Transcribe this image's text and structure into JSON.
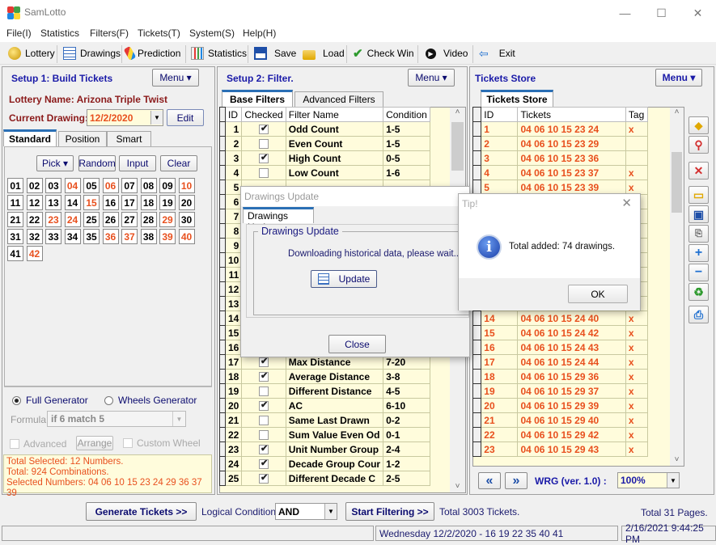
{
  "window": {
    "title": "SamLotto",
    "minimize": "—",
    "maximize": "☐",
    "close": "✕"
  },
  "menu": [
    "File(I)",
    "Statistics",
    "Filters(F)",
    "Tickets(T)",
    "System(S)",
    "Help(H)"
  ],
  "toolbar": {
    "lottery": "Lottery",
    "drawings": "Drawings",
    "prediction": "Prediction",
    "statistics": "Statistics",
    "save": "Save",
    "load": "Load",
    "check_win": "Check Win",
    "video": "Video",
    "exit": "Exit"
  },
  "setup1": {
    "title": "Setup 1: Build  Tickets",
    "menu_label": "Menu ▾",
    "lottery_name_label": "Lottery  Name: Arizona Triple Twist",
    "current_drawing_label": "Current Drawing:",
    "current_drawing_value": "12/2/2020",
    "edit_label": "Edit",
    "tabs": [
      "Standard",
      "Position",
      "Smart"
    ],
    "active_tab": "Standard",
    "pick_label": "Pick ▾",
    "random_label": "Random",
    "input_label": "Input",
    "clear_label": "Clear",
    "numbers": [
      "01",
      "02",
      "03",
      "04",
      "05",
      "06",
      "07",
      "08",
      "09",
      "10",
      "11",
      "12",
      "13",
      "14",
      "15",
      "16",
      "17",
      "18",
      "19",
      "20",
      "21",
      "22",
      "23",
      "24",
      "25",
      "26",
      "27",
      "28",
      "29",
      "30",
      "31",
      "32",
      "33",
      "34",
      "35",
      "36",
      "37",
      "38",
      "39",
      "40",
      "41",
      "42"
    ],
    "selected_numbers": [
      "04",
      "06",
      "10",
      "15",
      "23",
      "24",
      "29",
      "36",
      "37",
      "39",
      "40",
      "42"
    ],
    "full_generator": "Full Generator",
    "wheels_generator": "Wheels Generator",
    "formula_label": "Formula:",
    "formula_value": "if 6 match 5",
    "advanced_label": "Advanced",
    "arrange_label": "Arrange",
    "custom_wheel_label": "Custom Wheel",
    "summary": [
      "Total Selected: 12 Numbers.",
      "Total: 924 Combinations.",
      "Selected Numbers: 04 06 10 15 23 24 29 36 37 39"
    ]
  },
  "setup2": {
    "title": "Setup 2: Filter.",
    "menu_label": "Menu ▾",
    "tabs": [
      "Base Filters",
      "Advanced Filters"
    ],
    "columns": [
      "ID",
      "Checked",
      "Filter Name",
      "Condition"
    ],
    "rows_top": [
      {
        "id": "1",
        "checked": true,
        "name": "Odd Count",
        "cond": "1-5"
      },
      {
        "id": "2",
        "checked": false,
        "name": "Even Count",
        "cond": "1-5"
      },
      {
        "id": "3",
        "checked": true,
        "name": "High Count",
        "cond": "0-5"
      },
      {
        "id": "4",
        "checked": false,
        "name": "Low Count",
        "cond": "1-6"
      }
    ],
    "rows_hidden_ids": [
      "5",
      "6",
      "7",
      "8",
      "9",
      "10",
      "11",
      "12",
      "13",
      "14",
      "15",
      "16"
    ],
    "rows_bottom": [
      {
        "id": "17",
        "checked": true,
        "name": "Max Distance",
        "cond": "7-20"
      },
      {
        "id": "18",
        "checked": true,
        "name": "Average Distance",
        "cond": "3-8"
      },
      {
        "id": "19",
        "checked": false,
        "name": "Different Distance",
        "cond": "4-5"
      },
      {
        "id": "20",
        "checked": true,
        "name": "AC",
        "cond": "6-10"
      },
      {
        "id": "21",
        "checked": false,
        "name": "Same Last Drawn",
        "cond": "0-2"
      },
      {
        "id": "22",
        "checked": false,
        "name": "Sum Value Even Od",
        "cond": "0-1"
      },
      {
        "id": "23",
        "checked": true,
        "name": "Unit Number Group",
        "cond": "2-4"
      },
      {
        "id": "24",
        "checked": true,
        "name": "Decade Group Cour",
        "cond": "1-2"
      },
      {
        "id": "25",
        "checked": true,
        "name": "Different Decade C",
        "cond": "2-5"
      }
    ]
  },
  "store": {
    "title": "Tickets Store",
    "menu_label": "Menu ▾",
    "tab": "Tickets Store",
    "columns": [
      "ID",
      "Tickets",
      "Tag"
    ],
    "rows_top": [
      {
        "id": "1",
        "ticket": "04 06 10 15 23 24",
        "tag": "x"
      },
      {
        "id": "2",
        "ticket": "04 06 10 15 23 29",
        "tag": ""
      },
      {
        "id": "3",
        "ticket": "04 06 10 15 23 36",
        "tag": ""
      },
      {
        "id": "4",
        "ticket": "04 06 10 15 23 37",
        "tag": "x"
      },
      {
        "id": "5",
        "ticket": "04 06 10 15 23 39",
        "tag": "x"
      }
    ],
    "rows_bottom": [
      {
        "id": "14",
        "ticket": "04 06 10 15 24 40",
        "tag": "x"
      },
      {
        "id": "15",
        "ticket": "04 06 10 15 24 42",
        "tag": "x"
      },
      {
        "id": "16",
        "ticket": "04 06 10 15 24 43",
        "tag": "x"
      },
      {
        "id": "17",
        "ticket": "04 06 10 15 24 44",
        "tag": "x"
      },
      {
        "id": "18",
        "ticket": "04 06 10 15 29 36",
        "tag": "x"
      },
      {
        "id": "19",
        "ticket": "04 06 10 15 29 37",
        "tag": "x"
      },
      {
        "id": "20",
        "ticket": "04 06 10 15 29 39",
        "tag": "x"
      },
      {
        "id": "21",
        "ticket": "04 06 10 15 29 40",
        "tag": "x"
      },
      {
        "id": "22",
        "ticket": "04 06 10 15 29 42",
        "tag": "x"
      },
      {
        "id": "23",
        "ticket": "04 06 10 15 29 43",
        "tag": "x"
      }
    ],
    "prev": "«",
    "next": "»",
    "wrg_label": "WRG (ver. 1.0) :",
    "zoom_value": "100%"
  },
  "bottom": {
    "generate": "Generate Tickets >>",
    "logical_label": "Logical Condition:",
    "logical_value": "AND",
    "start_filtering": "Start Filtering >>",
    "total_tickets": "Total 3003 Tickets.",
    "total_pages": "Total 31 Pages."
  },
  "statusbar": {
    "drawing": "Wednesday 12/2/2020 - 16 19 22 35 40 41",
    "datetime": "2/16/2021 9:44:25 PM"
  },
  "drawings_dialog": {
    "title": "Drawings Update",
    "tab": "Drawings Update",
    "group": "Drawings Update",
    "message": "Downloading historical data, please wait...",
    "update": "Update",
    "close": "Close"
  },
  "tip_dialog": {
    "title": "Tip!",
    "message": "Total added: 74 drawings.",
    "ok": "OK"
  },
  "colors": {
    "accent": "#1a1aa8",
    "selected": "#e8501e",
    "grid_bg": "#fffcdc",
    "dark_red": "#8b1a1a"
  }
}
